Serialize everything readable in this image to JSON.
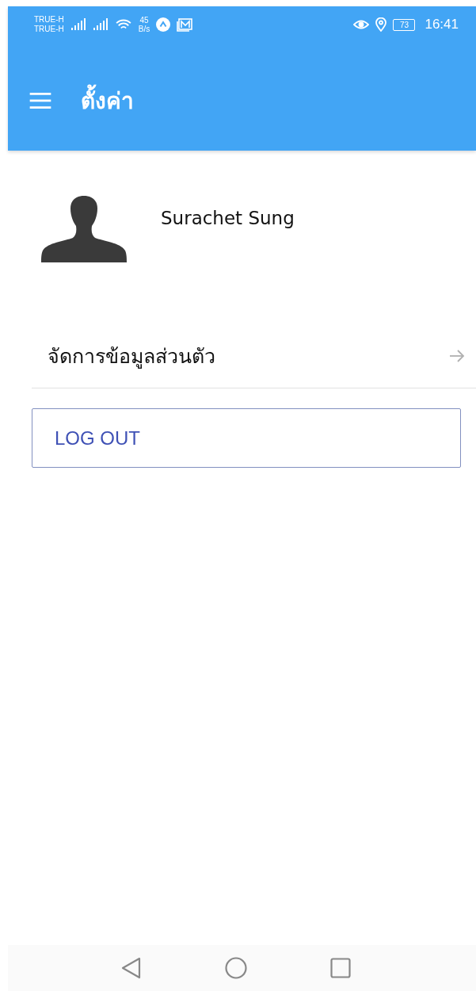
{
  "status_bar": {
    "carriers": [
      "TRUE-H",
      "TRUE-H"
    ],
    "speed_value": "45",
    "speed_unit": "B/s",
    "battery": "73",
    "time": "16:41"
  },
  "app_bar": {
    "title": "ตั้งค่า"
  },
  "profile": {
    "name": "Surachet Sung"
  },
  "menu_items": [
    {
      "label": "จัดการข้อมูลส่วนตัว"
    }
  ],
  "logout_button": {
    "label": "LOG OUT"
  }
}
